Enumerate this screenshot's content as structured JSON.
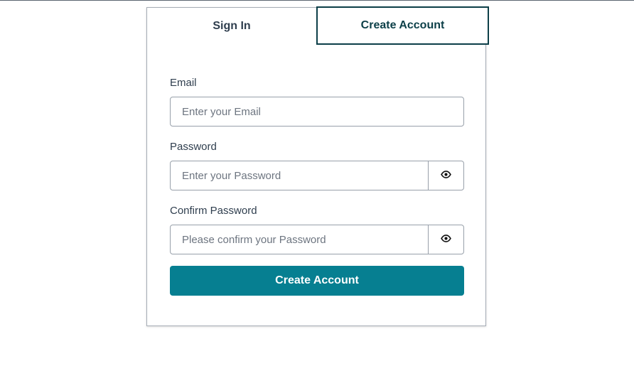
{
  "tabs": {
    "sign_in": "Sign In",
    "create_account": "Create Account",
    "active": "create_account"
  },
  "form": {
    "email": {
      "label": "Email",
      "placeholder": "Enter your Email",
      "value": ""
    },
    "password": {
      "label": "Password",
      "placeholder": "Enter your Password",
      "value": "",
      "toggle_icon": "eye-icon"
    },
    "confirm_password": {
      "label": "Confirm Password",
      "placeholder": "Please confirm your Password",
      "value": "",
      "toggle_icon": "eye-icon"
    },
    "submit_label": "Create Account"
  },
  "colors": {
    "accent": "#067f91",
    "active_tab_border": "#0c3f48",
    "text": "#2f3e4e"
  }
}
